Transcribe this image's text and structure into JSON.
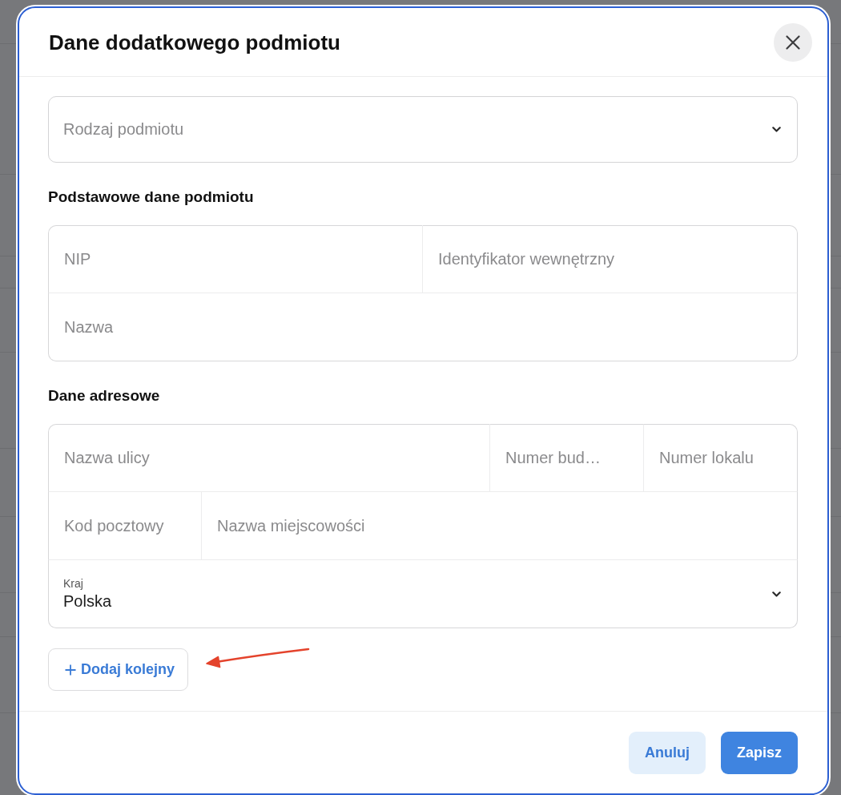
{
  "dialog": {
    "title": "Dane dodatkowego podmiotu"
  },
  "entity_type": {
    "kind": "select",
    "placeholder": "Rodzaj podmiotu"
  },
  "sections": [
    {
      "heading": "Podstawowe dane podmiotu",
      "rows": [
        [
          {
            "kind": "text",
            "placeholder": "NIP"
          },
          {
            "kind": "text",
            "placeholder": "Identyfikator wewnętrzny"
          }
        ],
        [
          {
            "kind": "text",
            "placeholder": "Nazwa"
          }
        ]
      ]
    },
    {
      "heading": "Dane adresowe",
      "rows": [
        [
          {
            "kind": "text",
            "placeholder": "Nazwa ulicy"
          },
          {
            "kind": "text",
            "placeholder": "Numer bud…"
          },
          {
            "kind": "text",
            "placeholder": "Numer lokalu"
          }
        ],
        [
          {
            "kind": "text",
            "placeholder": "Kod pocztowy"
          },
          {
            "kind": "text",
            "placeholder": "Nazwa miejscowości"
          }
        ],
        [
          {
            "kind": "select",
            "label": "Kraj",
            "value": "Polska"
          }
        ]
      ]
    }
  ],
  "add_button": {
    "label": "Dodaj kolejny"
  },
  "annotations": [
    {
      "kind": "arrow"
    }
  ],
  "footer": {
    "buttons": [
      {
        "kind": "secondary",
        "label": "Anuluj"
      },
      {
        "kind": "primary",
        "label": "Zapisz"
      }
    ]
  }
}
